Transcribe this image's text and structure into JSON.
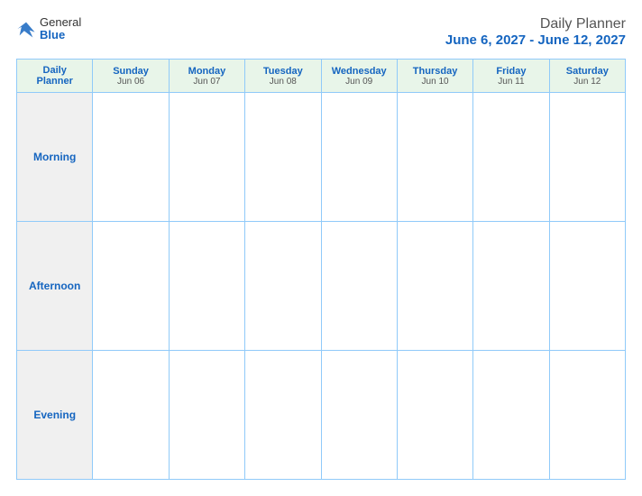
{
  "header": {
    "logo_general": "General",
    "logo_blue": "Blue",
    "title": "Daily Planner",
    "date_range": "June 6, 2027 - June 12, 2027"
  },
  "columns": [
    {
      "label": "Daily\nPlanner",
      "sub": "",
      "is_label": true
    },
    {
      "label": "Sunday",
      "sub": "Jun 06"
    },
    {
      "label": "Monday",
      "sub": "Jun 07"
    },
    {
      "label": "Tuesday",
      "sub": "Jun 08"
    },
    {
      "label": "Wednesday",
      "sub": "Jun 09"
    },
    {
      "label": "Thursday",
      "sub": "Jun 10"
    },
    {
      "label": "Friday",
      "sub": "Jun 11"
    },
    {
      "label": "Saturday",
      "sub": "Jun 12"
    }
  ],
  "rows": [
    {
      "label": "Morning"
    },
    {
      "label": "Afternoon"
    },
    {
      "label": "Evening"
    }
  ]
}
